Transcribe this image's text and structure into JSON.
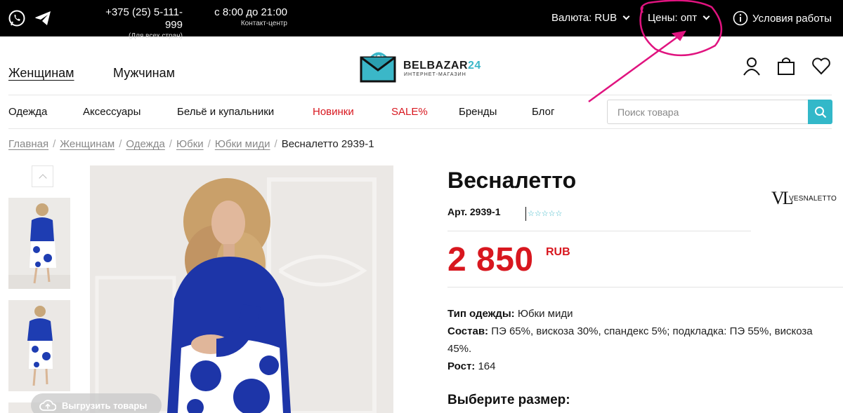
{
  "topbar": {
    "viber_icon": "viber-icon",
    "telegram_icon": "telegram-icon",
    "phone": "+375 (25) 5-111-999",
    "phone_sub": "(Для всех стран)",
    "hours": "с 8:00 до 21:00",
    "hours_sub": "Контакт-центр",
    "currency_label": "Валюта: RUB",
    "prices_label": "Цены: опт",
    "terms_label": "Условия работы"
  },
  "header": {
    "women": "Женщинам",
    "men": "Мужчинам",
    "logo_main": "BELBAZAR",
    "logo_num": "24",
    "logo_sub": "ИНТЕРНЕТ-МАГАЗИН"
  },
  "nav": {
    "items": [
      "Одежда",
      "Аксессуары",
      "Бельё и купальники",
      "Новинки",
      "SALE%",
      "Бренды",
      "Блог"
    ],
    "search_placeholder": "Поиск товара"
  },
  "breadcrumbs": {
    "items": [
      "Главная",
      "Женщинам",
      "Одежда",
      "Юбки",
      "Юбки миди"
    ],
    "current": "Весналетто 2939-1"
  },
  "gallery": {
    "export_label": "Выгрузить товары"
  },
  "product": {
    "title": "Весналетто",
    "brand_mark": "VL",
    "brand_name": "VESNALETTO",
    "sku": "Арт. 2939-1",
    "rating_stars": "☆☆☆☆☆",
    "price": "2 850",
    "currency": "RUB",
    "specs": [
      {
        "label": "Тип одежды:",
        "value": "Юбки миди"
      },
      {
        "label": "Состав:",
        "value": "ПЭ 65%, вискоза 30%, спандекс 5%; подкладка: ПЭ 55%, вискоза 45%."
      },
      {
        "label": "Рост:",
        "value": "164"
      }
    ],
    "size_title": "Выберите размер:"
  },
  "colors": {
    "accent": "#33b8c9",
    "sale": "#d8171f",
    "annotation": "#e0137f",
    "topbar": "#000000"
  }
}
